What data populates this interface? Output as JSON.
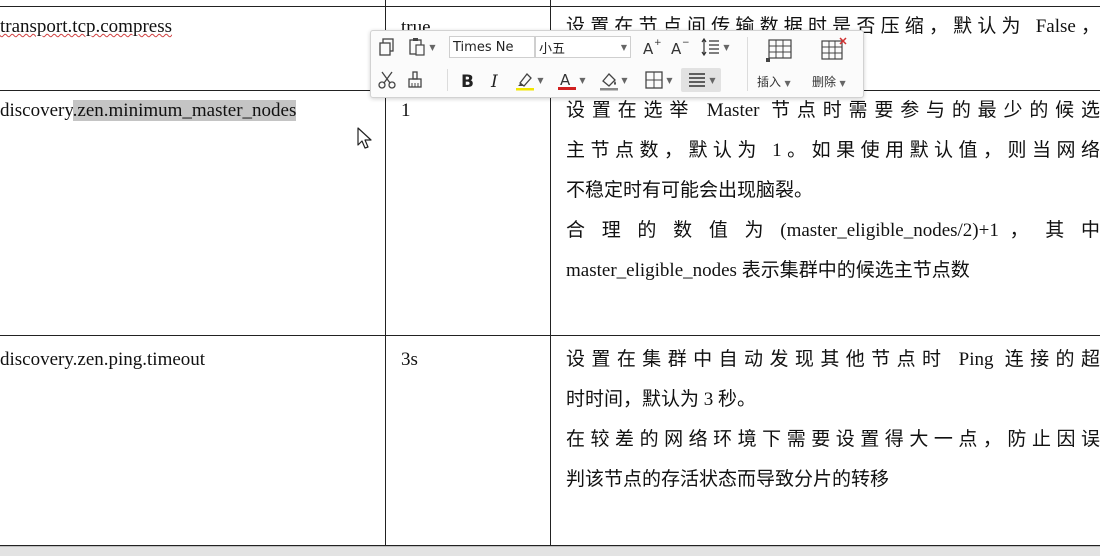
{
  "table": {
    "rows": [
      {
        "param": "transport.tcp.compress",
        "value": "true",
        "desc": [
          "设置在节点间传输数据时是否压缩，默认为 False，"
        ]
      },
      {
        "param_prefix": "discovery",
        "param_selected": ".zen.minimum_master_nodes",
        "value": "1",
        "desc": [
          "设置在选举 Master 节点时需要参与的最少的候选",
          "主节点数，默认为 1。如果使用默认值，则当网络",
          "不稳定时有可能会出现脑裂。",
          "合 理 的 数 值 为 (master_eligible_nodes/2)+1 ， 其 中",
          "master_eligible_nodes 表示集群中的候选主节点数"
        ]
      },
      {
        "param": "discovery.zen.ping.timeout",
        "value": "3s",
        "desc": [
          "设置在集群中自动发现其他节点时 Ping 连接的超",
          "时时间，默认为 3 秒。",
          "在较差的网络环境下需要设置得大一点，防止因误",
          "判该节点的存活状态而导致分片的转移"
        ]
      }
    ]
  },
  "toolbar": {
    "font_name": "Times Ne",
    "font_size": "小五",
    "insert_label": "插入",
    "delete_label": "删除",
    "icons": [
      "copy-icon",
      "paste-icon",
      "increase-font-icon",
      "decrease-font-icon",
      "line-spacing-icon",
      "insert-table-icon",
      "delete-table-icon",
      "cut-icon",
      "format-painter-icon",
      "bold-icon",
      "italic-icon",
      "highlight-icon",
      "font-color-icon",
      "shading-icon",
      "border-icon",
      "align-icon"
    ]
  },
  "colors": {
    "selection": "#c4c4c4",
    "font_color_bar": "#d02020",
    "highlight_bar": "#f2e600"
  }
}
